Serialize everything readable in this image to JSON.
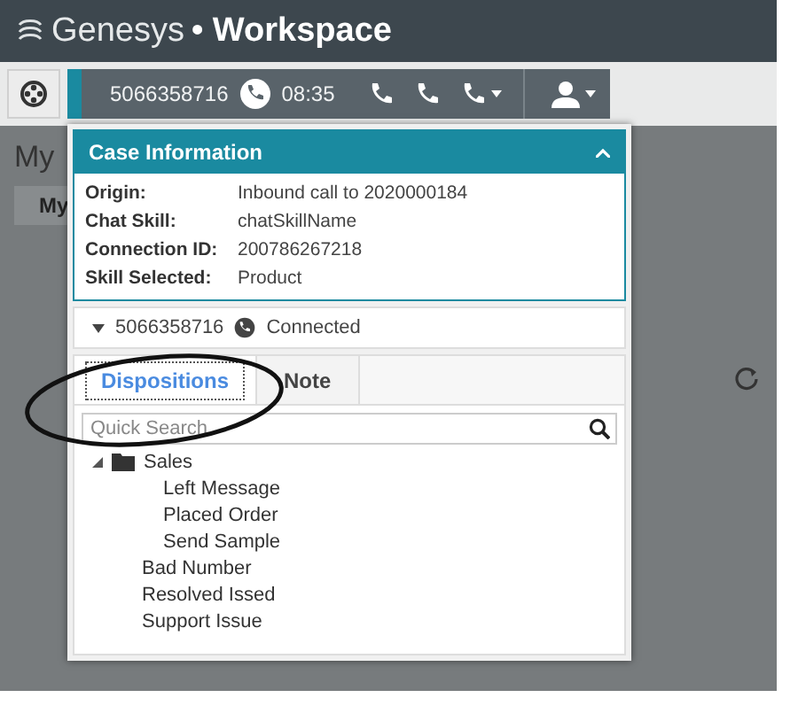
{
  "header": {
    "brand": "Genesys",
    "separator": "•",
    "product": "Workspace"
  },
  "toolbar": {
    "number": "5066358716",
    "timer": "08:35"
  },
  "background": {
    "heading": "My",
    "tab": "My"
  },
  "case_information": {
    "title": "Case Information",
    "expanded": true,
    "fields": [
      {
        "label": "Origin:",
        "value": "Inbound call to 2020000184"
      },
      {
        "label": "Chat Skill:",
        "value": "chatSkillName"
      },
      {
        "label": "Connection ID:",
        "value": "200786267218"
      },
      {
        "label": "Skill Selected:",
        "value": "Product"
      }
    ]
  },
  "interaction": {
    "number": "5066358716",
    "status": "Connected"
  },
  "tabs": [
    {
      "label": "Dispositions",
      "selected": true
    },
    {
      "label": "Note",
      "selected": false
    }
  ],
  "search": {
    "placeholder": "Quick Search"
  },
  "tree": [
    {
      "label": "Sales",
      "expanded": true,
      "children": [
        {
          "label": "Left Message"
        },
        {
          "label": "Placed Order"
        },
        {
          "label": "Send Sample"
        }
      ]
    },
    {
      "label": "Bad Number"
    },
    {
      "label": "Resolved Issed"
    },
    {
      "label": "Support Issue"
    }
  ]
}
